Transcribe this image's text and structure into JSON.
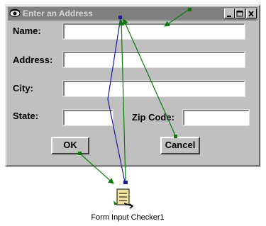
{
  "window": {
    "title": "Enter an Address",
    "icons": {
      "app": "eye-icon",
      "minimize": "minimize-icon",
      "maximize": "maximize-icon",
      "close": "close-icon"
    }
  },
  "form": {
    "name_label": "Name:",
    "address_label": "Address:",
    "city_label": "City:",
    "state_label": "State:",
    "zip_label": "Zip Code:",
    "name_value": "",
    "address_value": "",
    "city_value": "",
    "state_value": "",
    "zip_value": ""
  },
  "buttons": {
    "ok_label": "OK",
    "cancel_label": "Cancel"
  },
  "component": {
    "label": "Form Input Checker1",
    "icon": "form-checker-icon"
  },
  "colors": {
    "titlebar": "#808080",
    "dialog_face": "#c0c0c0",
    "wire_green": "#0a7a0a",
    "wire_blue": "#1a1aa0"
  }
}
